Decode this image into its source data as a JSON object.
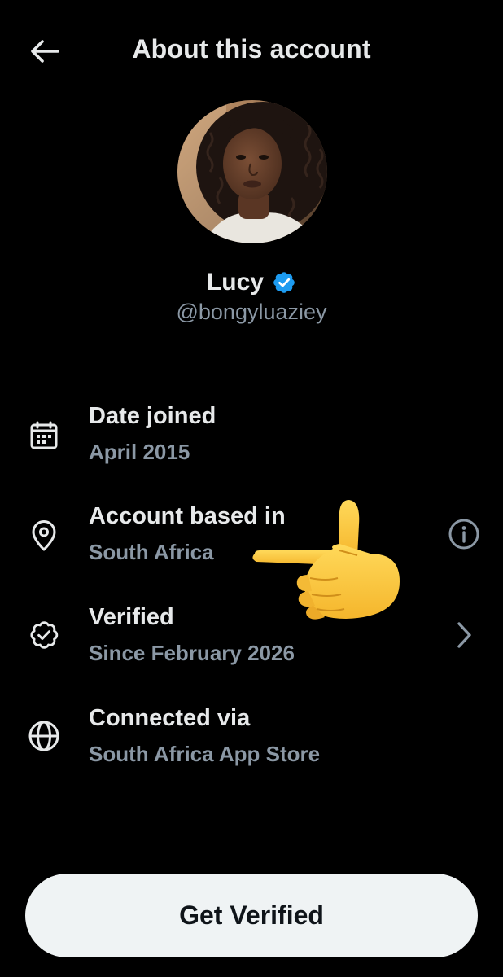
{
  "header": {
    "title": "About this account",
    "back_icon": "arrow-left-icon"
  },
  "profile": {
    "name": "Lucy",
    "handle": "@bongyluaziey",
    "verified_badge_icon": "verified-badge-icon",
    "badge_color": "#1d9bf0",
    "avatar": "profile-photo"
  },
  "rows": [
    {
      "icon": "calendar-icon",
      "label": "Date joined",
      "value": "April 2015"
    },
    {
      "icon": "location-pin-icon",
      "label": "Account based in",
      "value": "South Africa",
      "action_icon": "info-icon"
    },
    {
      "icon": "verified-check-icon",
      "label": "Verified",
      "value": "Since February 2026",
      "action_icon": "chevron-right-icon"
    },
    {
      "icon": "globe-icon",
      "label": "Connected via",
      "value": "South Africa App Store"
    }
  ],
  "overlay": {
    "emoji": "backhand-index-pointing-left-emoji"
  },
  "cta": {
    "label": "Get Verified"
  },
  "colors": {
    "background": "#000000",
    "primary_text": "#e7e9ea",
    "secondary_text": "#8b98a5",
    "button_bg": "#eff3f4",
    "button_text": "#0f1419",
    "accent": "#1d9bf0"
  }
}
